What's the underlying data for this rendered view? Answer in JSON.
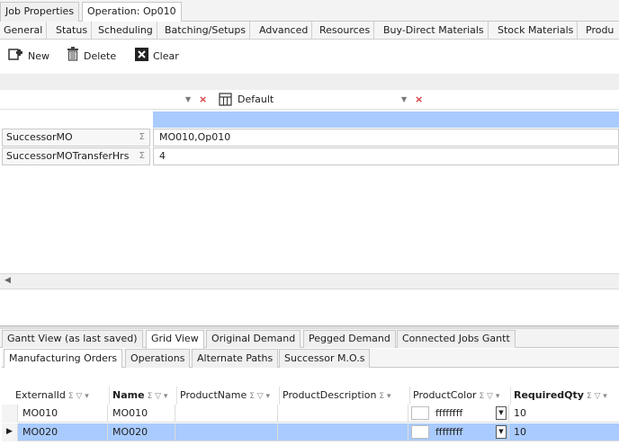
{
  "top_tabs": [
    {
      "label": "Job Properties",
      "active": false
    },
    {
      "label": "Operation: Op010",
      "active": true
    }
  ],
  "sub_tabs": [
    "General",
    "Status",
    "Scheduling",
    "Batching/Setups",
    "Advanced",
    "Resources",
    "Buy-Direct Materials",
    "Stock Materials",
    "Produ"
  ],
  "toolbar": {
    "new_label": "New",
    "delete_label": "Delete",
    "clear_label": "Clear"
  },
  "filter": {
    "layout_label": "Default"
  },
  "properties": [
    {
      "name": "SuccessorMO",
      "value": "MO010,Op010"
    },
    {
      "name": "SuccessorMOTransferHrs",
      "value": "4"
    }
  ],
  "bottom_tabs": [
    {
      "label": "Gantt View (as last saved)",
      "active": false
    },
    {
      "label": "Grid View",
      "active": true
    },
    {
      "label": "Original Demand",
      "active": false
    },
    {
      "label": "Pegged Demand",
      "active": false
    },
    {
      "label": "Connected Jobs Gantt",
      "active": false
    }
  ],
  "inner_tabs": [
    {
      "label": "Manufacturing Orders",
      "active": true
    },
    {
      "label": "Operations",
      "active": false
    },
    {
      "label": "Alternate Paths",
      "active": false
    },
    {
      "label": "Successor M.O.s",
      "active": false
    }
  ],
  "grid": {
    "columns": [
      "ExternalId",
      "Name",
      "ProductName",
      "ProductDescription",
      "ProductColor",
      "RequiredQty"
    ],
    "rows": [
      {
        "ExternalId": "MO010",
        "Name": "MO010",
        "ProductName": "",
        "ProductDescription": "",
        "ProductColor": "ffffffff",
        "RequiredQty": "10",
        "selected": false
      },
      {
        "ExternalId": "MO020",
        "Name": "MO020",
        "ProductName": "",
        "ProductDescription": "",
        "ProductColor": "ffffffff",
        "RequiredQty": "10",
        "selected": true
      }
    ]
  },
  "colors": {
    "selection": "#a9cbff",
    "close_x": "#d23a3a"
  }
}
